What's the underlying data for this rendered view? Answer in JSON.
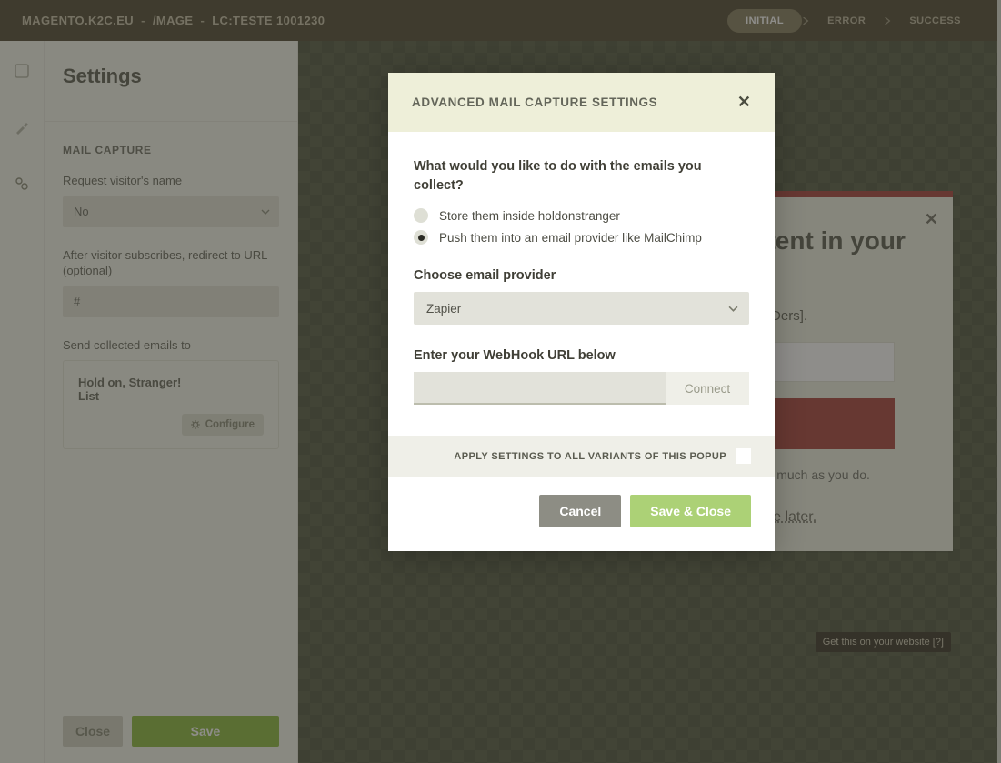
{
  "topbar": {
    "crumb1": "MAGENTO.K2C.EU",
    "crumb2": "/MAGE",
    "crumb3": "LC:TESTE 1001230",
    "sep": "-",
    "pills": {
      "initial": "INITIAL",
      "error": "ERROR",
      "success": "SUCCESS"
    }
  },
  "sidebar": {
    "title": "Settings",
    "section": "MAIL CAPTURE",
    "fields": {
      "requestName": {
        "label": "Request visitor's name",
        "value": "No"
      },
      "redirect": {
        "label": "After visitor subscribes, redirect to URL (optional)",
        "value": "#"
      },
      "sendTo": {
        "label": "Send collected emails to",
        "title": "Hold on, Stranger!",
        "sub": "List",
        "configure": "Configure"
      }
    },
    "footer": {
      "close": "Close",
      "save": "Save"
    }
  },
  "preview": {
    "heading": "Get the same content in your inbox",
    "sub": "Join the other [ABCDers].",
    "nospam": "No spam ever. We hate it just as much as you do.",
    "later": "No thank you! Maybe later.",
    "getThis": "Get this on your website [?]"
  },
  "modal": {
    "title": "ADVANCED MAIL CAPTURE SETTINGS",
    "question": "What would you like to do with the emails you collect?",
    "options": {
      "store": "Store them inside holdonstranger",
      "push": "Push them into an email provider like MailChimp"
    },
    "providerLabel": "Choose email provider",
    "providerValue": "Zapier",
    "webhookLabel": "Enter your WebHook URL below",
    "connect": "Connect",
    "applyAll": "APPLY SETTINGS TO ALL VARIANTS OF THIS POPUP",
    "cancel": "Cancel",
    "save": "Save & Close"
  }
}
